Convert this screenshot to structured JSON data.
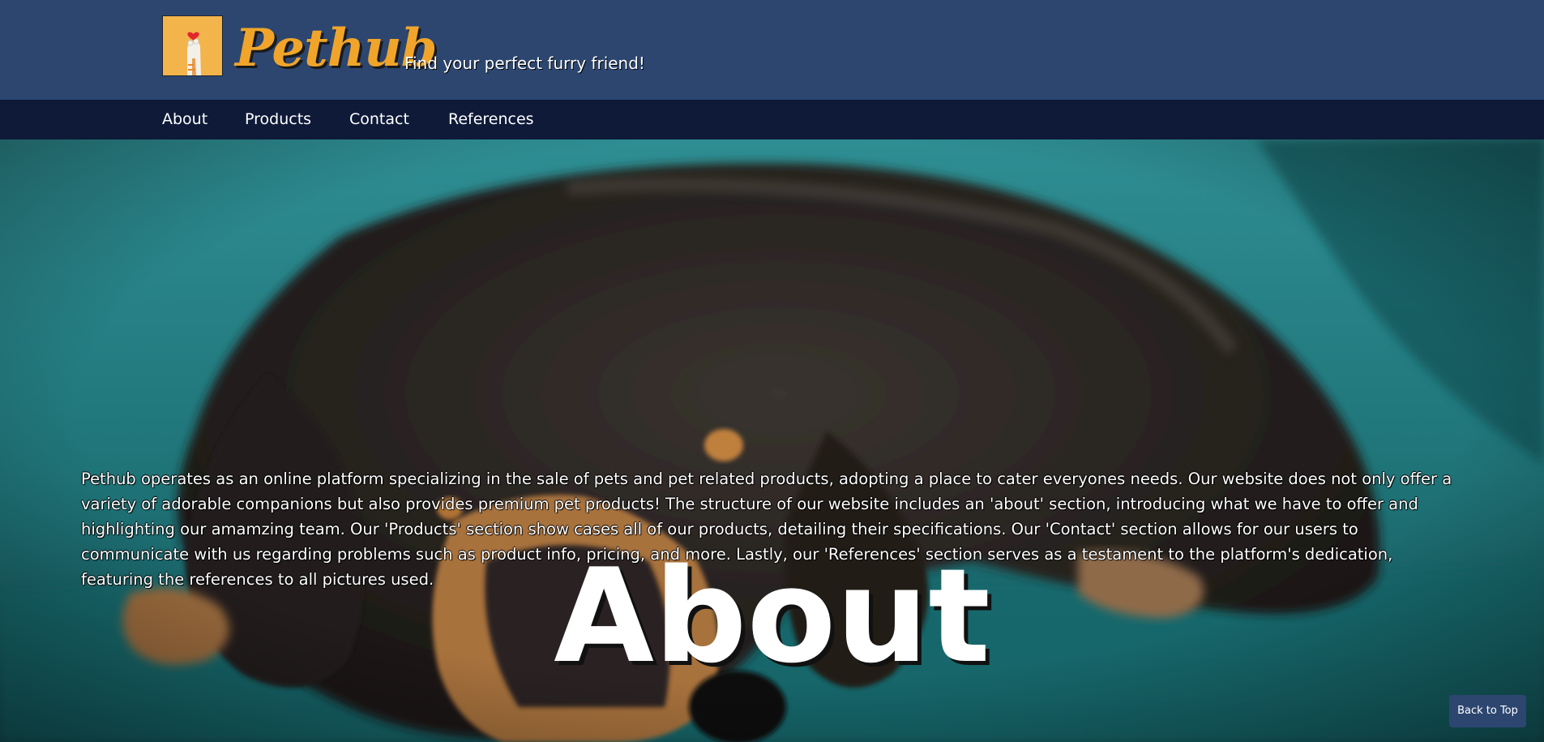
{
  "header": {
    "brand_name": "Pethub",
    "tagline": "Find your perfect furry friend!",
    "logo_icon": "cat-paw-heart-logo-icon"
  },
  "nav": {
    "items": [
      {
        "label": "About"
      },
      {
        "label": "Products"
      },
      {
        "label": "Contact"
      },
      {
        "label": "References"
      }
    ]
  },
  "hero": {
    "image": "sleeping-dachshund-on-teal-sofa",
    "description": "Pethub operates as an online platform specializing in the sale of pets and pet related products, adopting a place to cater everyones needs. Our website does not only offer a variety of adorable companions but also provides premium pet products! The structure of our website includes an 'about' section, introducing what we have to offer and highlighting our amamzing team. Our 'Products' section show cases all of our products, detailing their specifications. Our 'Contact' section allows for our users to communicate with us regarding problems such as product info, pricing, and more. Lastly, our 'References' section serves as a testament to the platform's dedication, featuring the references to all pictures used.",
    "title": "About"
  },
  "back_to_top": {
    "label": "Back to Top"
  },
  "colors": {
    "header_bg": "#2c4670",
    "nav_bg": "#0e1a38",
    "brand_orange": "#f0a52a",
    "logo_bg": "#f4b44c",
    "hero_teal": "#1d6e72"
  }
}
